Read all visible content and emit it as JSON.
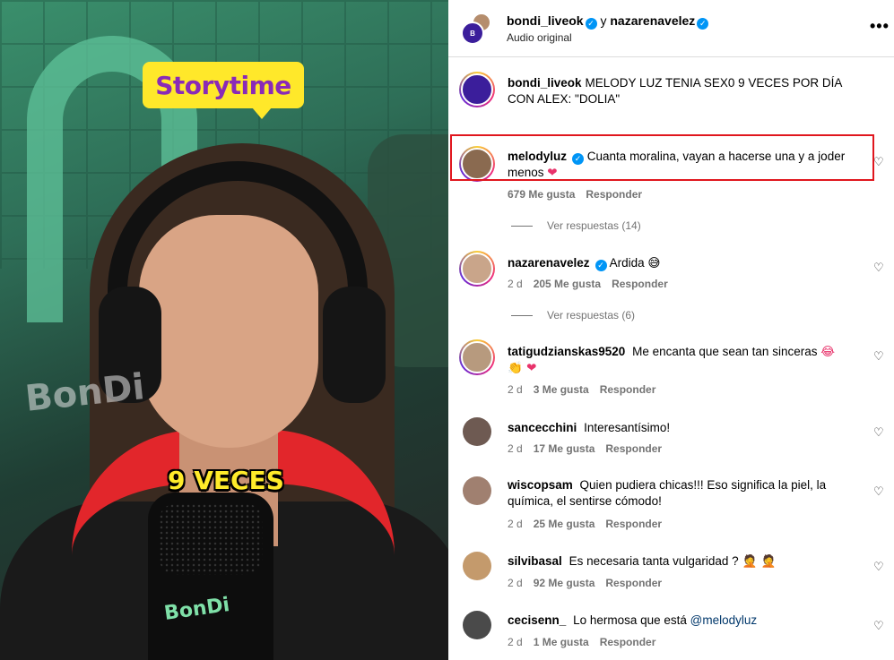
{
  "video": {
    "sticker": "Storytime",
    "caption": "9 VECES",
    "watermark": "BonDi",
    "mic_logo": "BonDi"
  },
  "header": {
    "user1": "bondi_liveok",
    "connector": "y",
    "user2": "nazarenavelez",
    "audio": "Audio original",
    "more": "•••"
  },
  "post": {
    "username": "bondi_liveok",
    "caption": "MELODY LUZ TENIA SEX0 9 VECES POR DÍA CON ALEX: \"DOLIA\""
  },
  "comments": [
    {
      "username": "melodyluz",
      "verified": true,
      "text": "Cuanta moralina, vayan a hacerse una y a joder menos",
      "emoji": "❤",
      "time": "",
      "likes": "679 Me gusta",
      "reply": "Responder",
      "view_replies": "Ver respuestas (14)",
      "avatar_color": "#8a6a50"
    },
    {
      "username": "nazarenavelez",
      "verified": true,
      "text": "Ardida",
      "emoji": "😅",
      "time": "2 d",
      "likes": "205 Me gusta",
      "reply": "Responder",
      "view_replies": "Ver respuestas (6)",
      "avatar_color": "#c9a58a"
    },
    {
      "username": "tatigudzianskas9520",
      "verified": false,
      "text": "Me encanta que sean tan sinceras",
      "emoji": "😂 👏 ❤",
      "time": "2 d",
      "likes": "3 Me gusta",
      "reply": "Responder",
      "avatar_color": "#b79a7e"
    },
    {
      "username": "sancecchini",
      "verified": false,
      "text": "Interesantísimo!",
      "time": "2 d",
      "likes": "17 Me gusta",
      "reply": "Responder",
      "avatar_color": "#6e5a52"
    },
    {
      "username": "wiscopsam",
      "verified": false,
      "text": "Quien pudiera chicas!!! Eso significa la piel, la química, el sentirse cómodo!",
      "time": "2 d",
      "likes": "25 Me gusta",
      "reply": "Responder",
      "avatar_color": "#a08070"
    },
    {
      "username": "silvibasal",
      "verified": false,
      "text": "Es necesaria tanta vulgaridad ?",
      "emoji": "🤦 🤦",
      "time": "2 d",
      "likes": "92 Me gusta",
      "reply": "Responder",
      "avatar_color": "#c49a6c"
    },
    {
      "username": "cecisenn_",
      "verified": false,
      "text": "Lo hermosa que está",
      "mention": "@melodyluz",
      "time": "2 d",
      "likes": "1 Me gusta",
      "reply": "Responder",
      "avatar_color": "#4a4a4a"
    }
  ],
  "colors": {
    "highlight": "#e0161e",
    "verified": "#0095f6",
    "sticker": "#ffe82a",
    "sticker_text": "#8a2ab7"
  },
  "icons": {
    "heart": "heart-icon",
    "verified": "verified-badge-icon",
    "more": "more-options-icon"
  }
}
